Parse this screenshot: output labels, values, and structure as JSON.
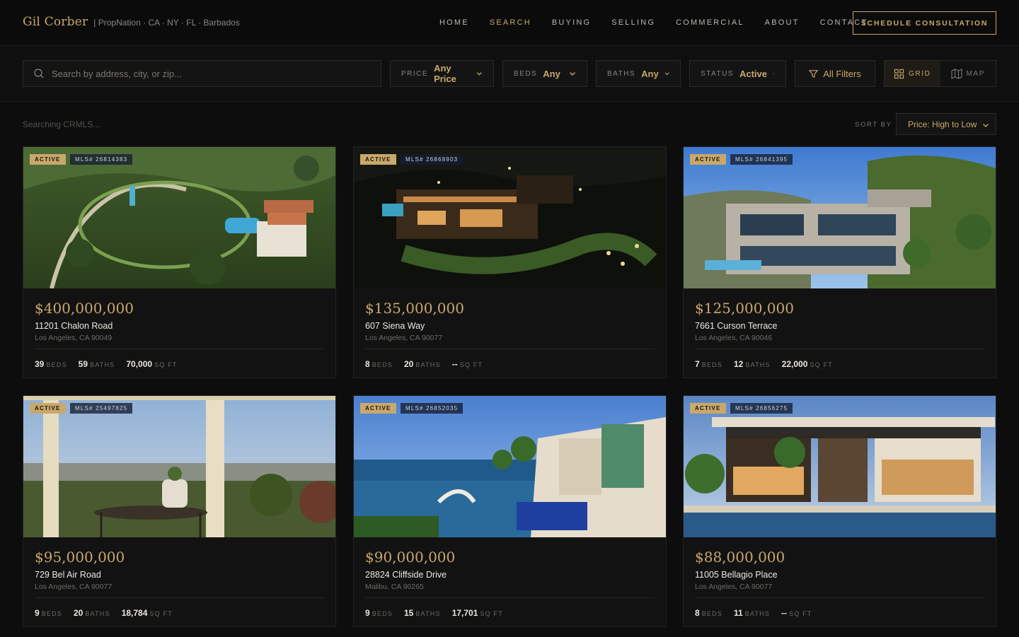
{
  "brand": {
    "name": "Gil Corber",
    "tagline": "| PropNation · CA · NY · FL · Barbados"
  },
  "nav": {
    "items": [
      "HOME",
      "SEARCH",
      "BUYING",
      "SELLING",
      "COMMERCIAL",
      "ABOUT",
      "CONTACT"
    ],
    "active": "SEARCH"
  },
  "cta": {
    "label": "SCHEDULE CONSULTATION"
  },
  "search": {
    "placeholder": "Search by address, city, or zip...",
    "value": ""
  },
  "filters": {
    "price": {
      "label": "PRICE",
      "value": "Any Price"
    },
    "beds": {
      "label": "BEDS",
      "value": "Any"
    },
    "baths": {
      "label": "BATHS",
      "value": "Any"
    },
    "status": {
      "label": "STATUS",
      "value": "Active"
    },
    "all_filters": "All Filters"
  },
  "view_toggle": {
    "grid": "GRID",
    "map": "MAP",
    "selected": "GRID"
  },
  "results": {
    "status_text": "Searching CRMLS...",
    "sort_label": "SORT BY",
    "sort_value": "Price: High to Low"
  },
  "colors": {
    "accent": "#c9a86b",
    "background": "#0d0d0d",
    "card": "#121212"
  },
  "listings": [
    {
      "status": "ACTIVE",
      "mls": "MLS# 26814383",
      "price": "$400,000,000",
      "address": "11201 Chalon Road",
      "city": "Los Angeles, CA 90049",
      "beds": "39",
      "baths": "59",
      "sqft": "70,000",
      "beds_unit": "BEDS",
      "baths_unit": "BATHS",
      "sqft_unit": "SQ FT"
    },
    {
      "status": "ACTIVE",
      "mls": "MLS# 26868903",
      "price": "$135,000,000",
      "address": "607 Siena Way",
      "city": "Los Angeles, CA 90077",
      "beds": "8",
      "baths": "20",
      "sqft": "--",
      "beds_unit": "BEDS",
      "baths_unit": "BATHS",
      "sqft_unit": "SQ FT"
    },
    {
      "status": "ACTIVE",
      "mls": "MLS# 26841395",
      "price": "$125,000,000",
      "address": "7661 Curson Terrace",
      "city": "Los Angeles, CA 90046",
      "beds": "7",
      "baths": "12",
      "sqft": "22,000",
      "beds_unit": "BEDS",
      "baths_unit": "BATHS",
      "sqft_unit": "SQ FT"
    },
    {
      "status": "ACTIVE",
      "mls": "MLS# 25497825",
      "price": "$95,000,000",
      "address": "729 Bel Air Road",
      "city": "Los Angeles, CA 90077",
      "beds": "9",
      "baths": "20",
      "sqft": "18,784",
      "beds_unit": "BEDS",
      "baths_unit": "BATHS",
      "sqft_unit": "SQ FT"
    },
    {
      "status": "ACTIVE",
      "mls": "MLS# 26852035",
      "price": "$90,000,000",
      "address": "28824 Cliffside Drive",
      "city": "Malibu, CA 90265",
      "beds": "9",
      "baths": "15",
      "sqft": "17,701",
      "beds_unit": "BEDS",
      "baths_unit": "BATHS",
      "sqft_unit": "SQ FT"
    },
    {
      "status": "ACTIVE",
      "mls": "MLS# 26856275",
      "price": "$88,000,000",
      "address": "11005 Bellagio Place",
      "city": "Los Angeles, CA 90077",
      "beds": "8",
      "baths": "11",
      "sqft": "--",
      "beds_unit": "BEDS",
      "baths_unit": "BATHS",
      "sqft_unit": "SQ FT"
    }
  ]
}
